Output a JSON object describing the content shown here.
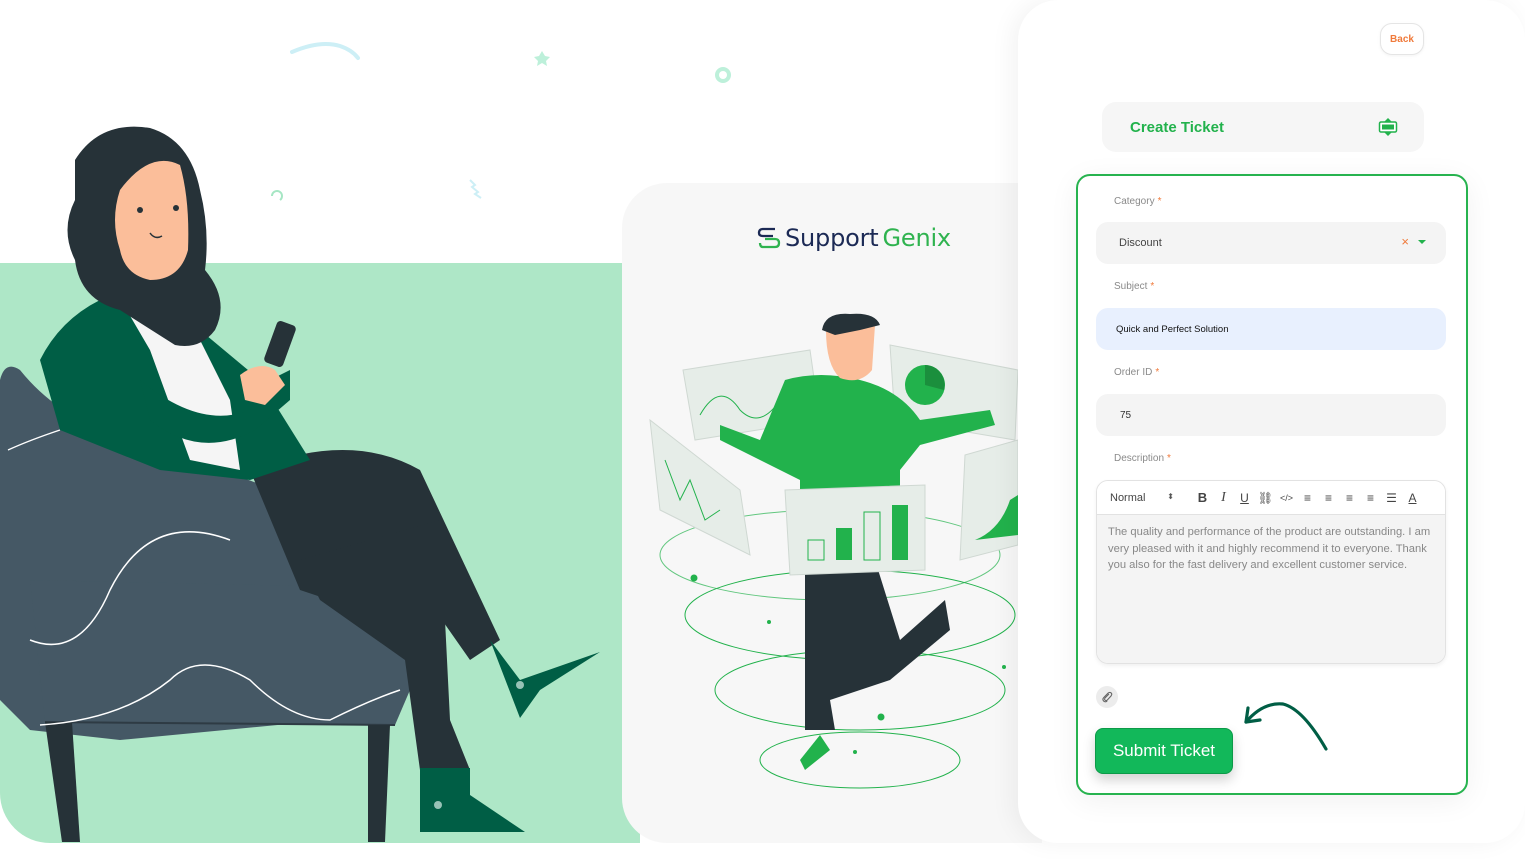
{
  "brand": {
    "name_part1": "Support",
    "name_part2": "Genix",
    "logo_icon": "sg-logo-icon"
  },
  "nav": {
    "back_label": "Back"
  },
  "header": {
    "title": "Create Ticket",
    "icon": "ticket-icon"
  },
  "form": {
    "category": {
      "label": "Category",
      "required_mark": "*",
      "value": "Discount",
      "clear_icon": "×"
    },
    "subject": {
      "label": "Subject",
      "required_mark": "*",
      "value": "Quick and Perfect Solution"
    },
    "order_id": {
      "label": "Order ID",
      "required_mark": "*",
      "value": "75"
    },
    "description": {
      "label": "Description",
      "required_mark": "*",
      "format_select": "Normal",
      "format_arrows": "⬍",
      "toolbar": [
        {
          "name": "bold-button",
          "glyph": "B"
        },
        {
          "name": "italic-button",
          "glyph": "I"
        },
        {
          "name": "underline-button",
          "glyph": "U"
        },
        {
          "name": "link-button",
          "glyph": "⛓"
        },
        {
          "name": "code-button",
          "glyph": "</>"
        },
        {
          "name": "align-left-button",
          "glyph": "≡"
        },
        {
          "name": "align-center-button",
          "glyph": "≡"
        },
        {
          "name": "align-right-button",
          "glyph": "≡"
        },
        {
          "name": "align-justify-button",
          "glyph": "≡"
        },
        {
          "name": "ordered-list-button",
          "glyph": "☰"
        },
        {
          "name": "text-color-button",
          "glyph": "A"
        }
      ],
      "value": "The quality and performance of the product are outstanding. I am very pleased with it and highly recommend it to everyone. Thank you also for the fast delivery and excellent customer service."
    },
    "attach_icon": "paperclip-icon",
    "submit_label": "Submit Ticket"
  },
  "colors": {
    "accent_green": "#22b24c",
    "button_green": "#12b85a",
    "accent_orange": "#f07a3b",
    "mint_background": "#aee7c7",
    "brand_navy": "#1c2a55"
  }
}
